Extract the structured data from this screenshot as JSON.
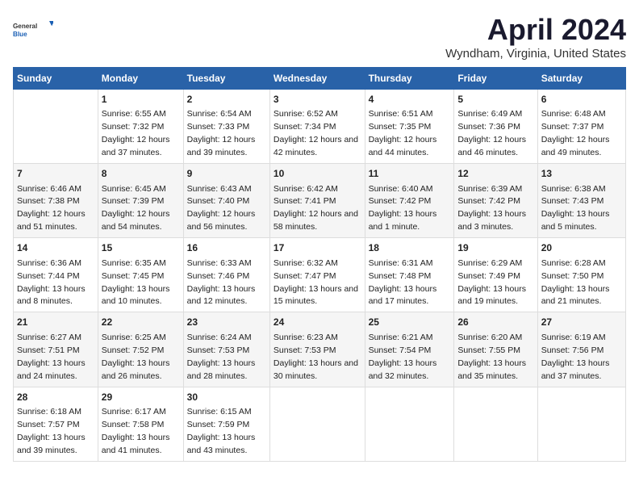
{
  "logo": {
    "general": "General",
    "blue": "Blue"
  },
  "title": "April 2024",
  "subtitle": "Wyndham, Virginia, United States",
  "days_header": [
    "Sunday",
    "Monday",
    "Tuesday",
    "Wednesday",
    "Thursday",
    "Friday",
    "Saturday"
  ],
  "weeks": [
    [
      {
        "num": "",
        "sunrise": "",
        "sunset": "",
        "daylight": ""
      },
      {
        "num": "1",
        "sunrise": "Sunrise: 6:55 AM",
        "sunset": "Sunset: 7:32 PM",
        "daylight": "Daylight: 12 hours and 37 minutes."
      },
      {
        "num": "2",
        "sunrise": "Sunrise: 6:54 AM",
        "sunset": "Sunset: 7:33 PM",
        "daylight": "Daylight: 12 hours and 39 minutes."
      },
      {
        "num": "3",
        "sunrise": "Sunrise: 6:52 AM",
        "sunset": "Sunset: 7:34 PM",
        "daylight": "Daylight: 12 hours and 42 minutes."
      },
      {
        "num": "4",
        "sunrise": "Sunrise: 6:51 AM",
        "sunset": "Sunset: 7:35 PM",
        "daylight": "Daylight: 12 hours and 44 minutes."
      },
      {
        "num": "5",
        "sunrise": "Sunrise: 6:49 AM",
        "sunset": "Sunset: 7:36 PM",
        "daylight": "Daylight: 12 hours and 46 minutes."
      },
      {
        "num": "6",
        "sunrise": "Sunrise: 6:48 AM",
        "sunset": "Sunset: 7:37 PM",
        "daylight": "Daylight: 12 hours and 49 minutes."
      }
    ],
    [
      {
        "num": "7",
        "sunrise": "Sunrise: 6:46 AM",
        "sunset": "Sunset: 7:38 PM",
        "daylight": "Daylight: 12 hours and 51 minutes."
      },
      {
        "num": "8",
        "sunrise": "Sunrise: 6:45 AM",
        "sunset": "Sunset: 7:39 PM",
        "daylight": "Daylight: 12 hours and 54 minutes."
      },
      {
        "num": "9",
        "sunrise": "Sunrise: 6:43 AM",
        "sunset": "Sunset: 7:40 PM",
        "daylight": "Daylight: 12 hours and 56 minutes."
      },
      {
        "num": "10",
        "sunrise": "Sunrise: 6:42 AM",
        "sunset": "Sunset: 7:41 PM",
        "daylight": "Daylight: 12 hours and 58 minutes."
      },
      {
        "num": "11",
        "sunrise": "Sunrise: 6:40 AM",
        "sunset": "Sunset: 7:42 PM",
        "daylight": "Daylight: 13 hours and 1 minute."
      },
      {
        "num": "12",
        "sunrise": "Sunrise: 6:39 AM",
        "sunset": "Sunset: 7:42 PM",
        "daylight": "Daylight: 13 hours and 3 minutes."
      },
      {
        "num": "13",
        "sunrise": "Sunrise: 6:38 AM",
        "sunset": "Sunset: 7:43 PM",
        "daylight": "Daylight: 13 hours and 5 minutes."
      }
    ],
    [
      {
        "num": "14",
        "sunrise": "Sunrise: 6:36 AM",
        "sunset": "Sunset: 7:44 PM",
        "daylight": "Daylight: 13 hours and 8 minutes."
      },
      {
        "num": "15",
        "sunrise": "Sunrise: 6:35 AM",
        "sunset": "Sunset: 7:45 PM",
        "daylight": "Daylight: 13 hours and 10 minutes."
      },
      {
        "num": "16",
        "sunrise": "Sunrise: 6:33 AM",
        "sunset": "Sunset: 7:46 PM",
        "daylight": "Daylight: 13 hours and 12 minutes."
      },
      {
        "num": "17",
        "sunrise": "Sunrise: 6:32 AM",
        "sunset": "Sunset: 7:47 PM",
        "daylight": "Daylight: 13 hours and 15 minutes."
      },
      {
        "num": "18",
        "sunrise": "Sunrise: 6:31 AM",
        "sunset": "Sunset: 7:48 PM",
        "daylight": "Daylight: 13 hours and 17 minutes."
      },
      {
        "num": "19",
        "sunrise": "Sunrise: 6:29 AM",
        "sunset": "Sunset: 7:49 PM",
        "daylight": "Daylight: 13 hours and 19 minutes."
      },
      {
        "num": "20",
        "sunrise": "Sunrise: 6:28 AM",
        "sunset": "Sunset: 7:50 PM",
        "daylight": "Daylight: 13 hours and 21 minutes."
      }
    ],
    [
      {
        "num": "21",
        "sunrise": "Sunrise: 6:27 AM",
        "sunset": "Sunset: 7:51 PM",
        "daylight": "Daylight: 13 hours and 24 minutes."
      },
      {
        "num": "22",
        "sunrise": "Sunrise: 6:25 AM",
        "sunset": "Sunset: 7:52 PM",
        "daylight": "Daylight: 13 hours and 26 minutes."
      },
      {
        "num": "23",
        "sunrise": "Sunrise: 6:24 AM",
        "sunset": "Sunset: 7:53 PM",
        "daylight": "Daylight: 13 hours and 28 minutes."
      },
      {
        "num": "24",
        "sunrise": "Sunrise: 6:23 AM",
        "sunset": "Sunset: 7:53 PM",
        "daylight": "Daylight: 13 hours and 30 minutes."
      },
      {
        "num": "25",
        "sunrise": "Sunrise: 6:21 AM",
        "sunset": "Sunset: 7:54 PM",
        "daylight": "Daylight: 13 hours and 32 minutes."
      },
      {
        "num": "26",
        "sunrise": "Sunrise: 6:20 AM",
        "sunset": "Sunset: 7:55 PM",
        "daylight": "Daylight: 13 hours and 35 minutes."
      },
      {
        "num": "27",
        "sunrise": "Sunrise: 6:19 AM",
        "sunset": "Sunset: 7:56 PM",
        "daylight": "Daylight: 13 hours and 37 minutes."
      }
    ],
    [
      {
        "num": "28",
        "sunrise": "Sunrise: 6:18 AM",
        "sunset": "Sunset: 7:57 PM",
        "daylight": "Daylight: 13 hours and 39 minutes."
      },
      {
        "num": "29",
        "sunrise": "Sunrise: 6:17 AM",
        "sunset": "Sunset: 7:58 PM",
        "daylight": "Daylight: 13 hours and 41 minutes."
      },
      {
        "num": "30",
        "sunrise": "Sunrise: 6:15 AM",
        "sunset": "Sunset: 7:59 PM",
        "daylight": "Daylight: 13 hours and 43 minutes."
      },
      {
        "num": "",
        "sunrise": "",
        "sunset": "",
        "daylight": ""
      },
      {
        "num": "",
        "sunrise": "",
        "sunset": "",
        "daylight": ""
      },
      {
        "num": "",
        "sunrise": "",
        "sunset": "",
        "daylight": ""
      },
      {
        "num": "",
        "sunrise": "",
        "sunset": "",
        "daylight": ""
      }
    ]
  ]
}
